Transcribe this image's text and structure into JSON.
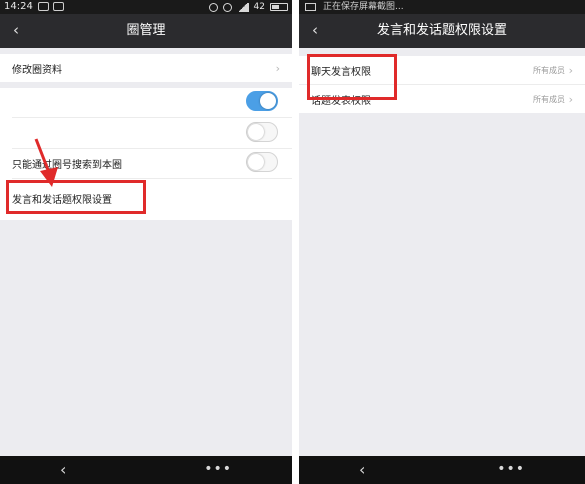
{
  "left_screen": {
    "status": {
      "time": "14:24",
      "battery": "42"
    },
    "title": "圈管理",
    "rows": {
      "edit_profile": "修改圈资料",
      "search_only": "只能通过圈号搜索到本圈",
      "speech_settings": "发言和发话题权限设置"
    },
    "toggles": [
      {
        "state": "on"
      },
      {
        "state": "off"
      },
      {
        "state": "off"
      }
    ]
  },
  "right_screen": {
    "status": {
      "notice": "正在保存屏幕截图..."
    },
    "title": "发言和发话题权限设置",
    "rows": [
      {
        "label": "聊天发言权限",
        "value": "所有成员"
      },
      {
        "label": "话题发表权限",
        "value": "所有成员"
      }
    ]
  },
  "icons": {
    "back": "back-arrow-icon",
    "more": "more-dots-icon",
    "chevron": "chevron-right-icon"
  },
  "colors": {
    "highlight": "#e02a2a",
    "toggle_on": "#4b9fe6",
    "titlebar": "#2b2b2e"
  }
}
